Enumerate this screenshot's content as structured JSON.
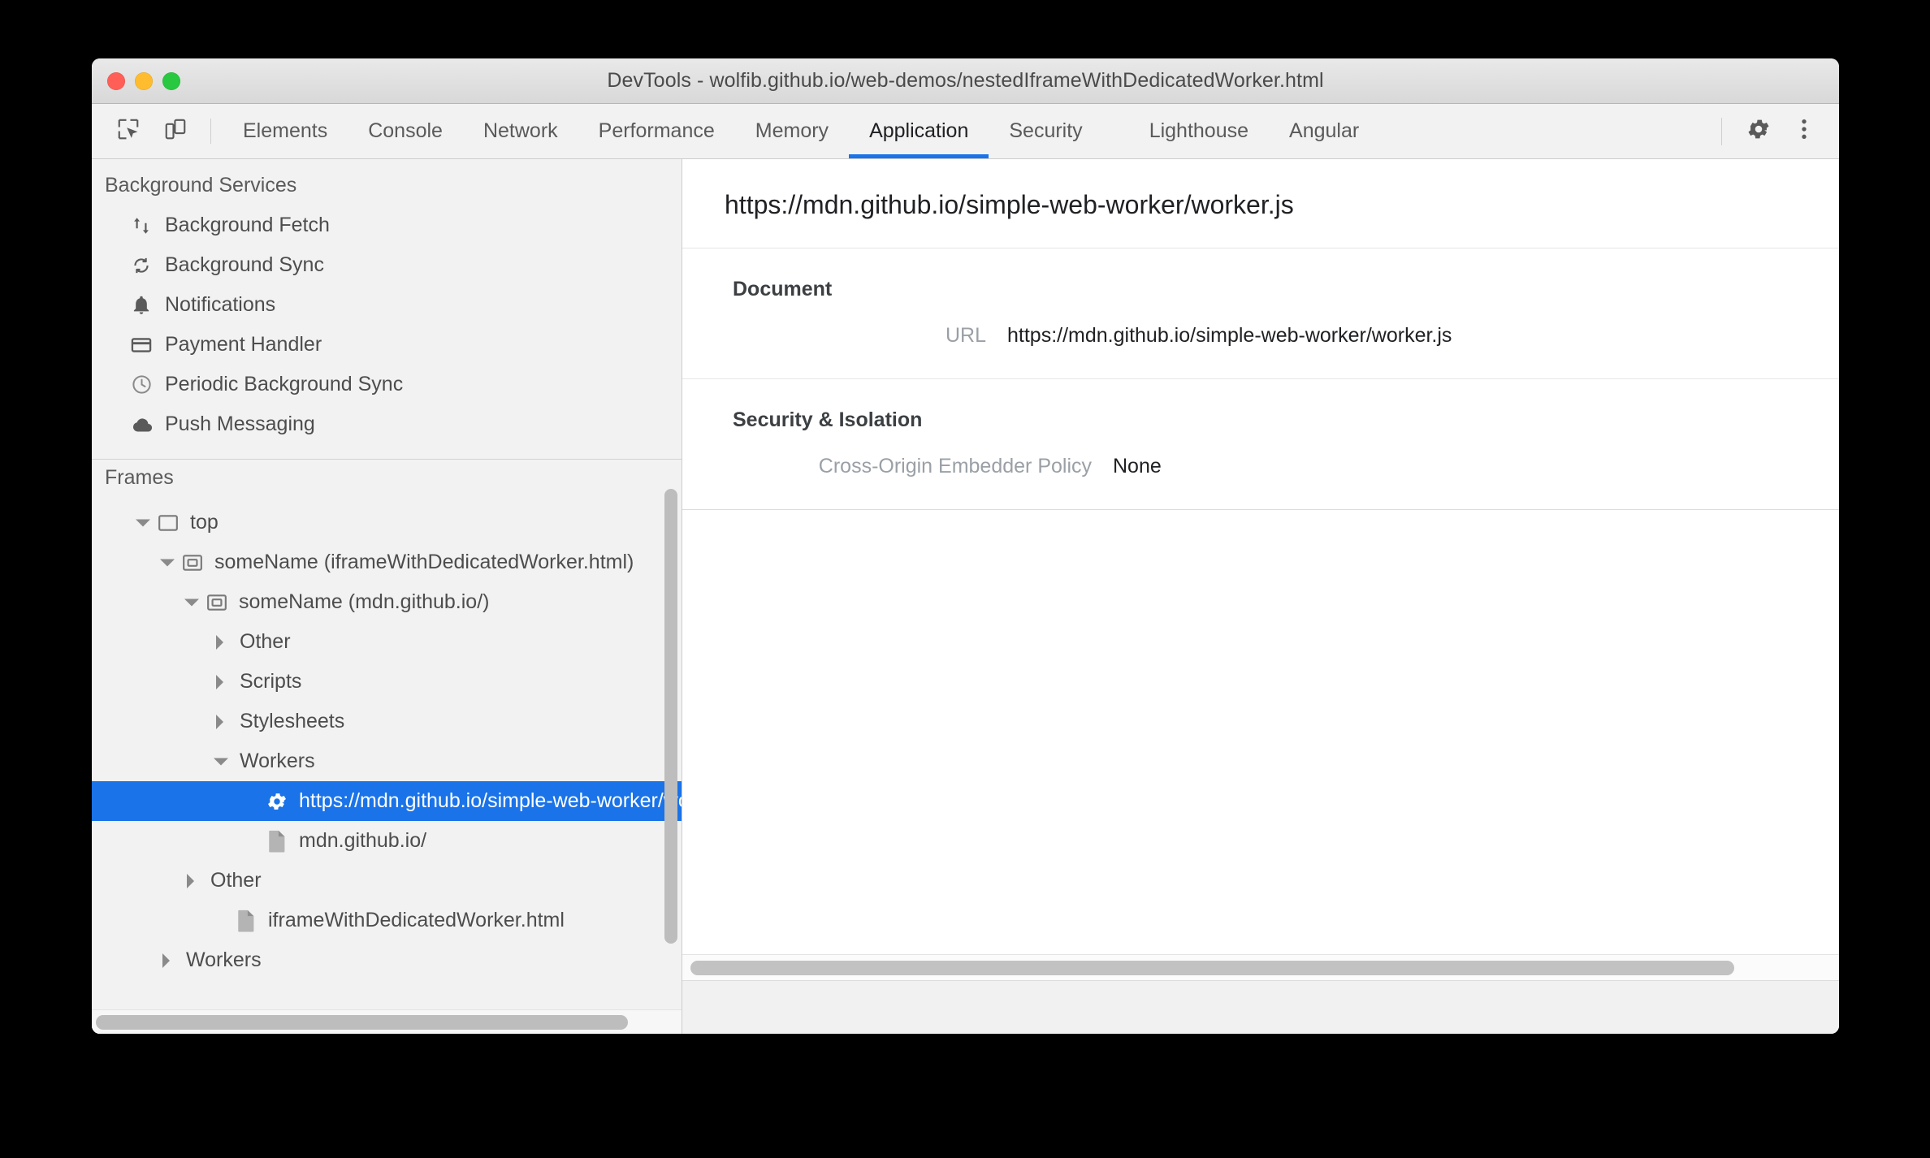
{
  "window": {
    "title": "DevTools - wolfib.github.io/web-demos/nestedIframeWithDedicatedWorker.html",
    "traffic": {
      "close": "close-button",
      "minimize": "minimize-button",
      "maximize": "maximize-button"
    }
  },
  "toolbar": {
    "inspect_icon": "inspect-element-icon",
    "device_icon": "device-toolbar-icon",
    "settings_icon": "gear-icon",
    "more_icon": "more-options-icon",
    "tabs": [
      {
        "label": "Elements",
        "active": false
      },
      {
        "label": "Console",
        "active": false
      },
      {
        "label": "Network",
        "active": false
      },
      {
        "label": "Performance",
        "active": false
      },
      {
        "label": "Memory",
        "active": false
      },
      {
        "label": "Application",
        "active": true
      },
      {
        "label": "Security",
        "active": false
      },
      {
        "label": "Lighthouse",
        "active": false
      },
      {
        "label": "Angular",
        "active": false
      }
    ]
  },
  "sidebar": {
    "background_services": {
      "header": "Background Services",
      "items": [
        {
          "label": "Background Fetch",
          "icon": "arrows-up-down-icon"
        },
        {
          "label": "Background Sync",
          "icon": "sync-refresh-icon"
        },
        {
          "label": "Notifications",
          "icon": "bell-icon"
        },
        {
          "label": "Payment Handler",
          "icon": "credit-card-icon"
        },
        {
          "label": "Periodic Background Sync",
          "icon": "clock-icon"
        },
        {
          "label": "Push Messaging",
          "icon": "cloud-icon"
        }
      ]
    },
    "frames": {
      "header": "Frames",
      "nodes": [
        {
          "label": "top",
          "icon": "frame-icon",
          "twisty": "open",
          "depth": 0,
          "selected": false
        },
        {
          "label": "someName (iframeWithDedicatedWorker.html)",
          "icon": "iframe-icon",
          "twisty": "open",
          "depth": 1,
          "selected": false
        },
        {
          "label": "someName (mdn.github.io/)",
          "icon": "iframe-icon",
          "twisty": "open",
          "depth": 2,
          "selected": false
        },
        {
          "label": "Other",
          "icon": "none",
          "twisty": "closed",
          "depth": 3,
          "selected": false
        },
        {
          "label": "Scripts",
          "icon": "none",
          "twisty": "closed",
          "depth": 3,
          "selected": false
        },
        {
          "label": "Stylesheets",
          "icon": "none",
          "twisty": "closed",
          "depth": 3,
          "selected": false
        },
        {
          "label": "Workers",
          "icon": "none",
          "twisty": "open",
          "depth": 3,
          "selected": false
        },
        {
          "label": "https://mdn.github.io/simple-web-worker/worker.js",
          "icon": "gear-icon",
          "twisty": "none",
          "depth": 4,
          "selected": true
        },
        {
          "label": "mdn.github.io/",
          "icon": "document-icon",
          "twisty": "none",
          "depth": 4,
          "selected": false
        },
        {
          "label": "Other",
          "icon": "none",
          "twisty": "closed",
          "depth": 2,
          "selected": false
        },
        {
          "label": "iframeWithDedicatedWorker.html",
          "icon": "document-icon",
          "twisty": "none",
          "depth": 3,
          "selected": false
        },
        {
          "label": "Workers",
          "icon": "none",
          "twisty": "closed",
          "depth": 1,
          "selected": false
        }
      ]
    }
  },
  "detail": {
    "title": "https://mdn.github.io/simple-web-worker/worker.js",
    "groups": [
      {
        "title": "Document",
        "fields": [
          {
            "label": "URL",
            "value": "https://mdn.github.io/simple-web-worker/worker.js",
            "wide": false
          }
        ]
      },
      {
        "title": "Security & Isolation",
        "fields": [
          {
            "label": "Cross-Origin Embedder Policy",
            "value": "None",
            "wide": true
          }
        ]
      }
    ]
  },
  "colors": {
    "accent": "#1a73e8",
    "selection_bg": "#1a73e8",
    "toolbar_bg": "#f2f2f2",
    "sidebar_bg": "#f2f2f2",
    "text": "#4d4d4d",
    "muted_text": "#9aa0a6"
  }
}
